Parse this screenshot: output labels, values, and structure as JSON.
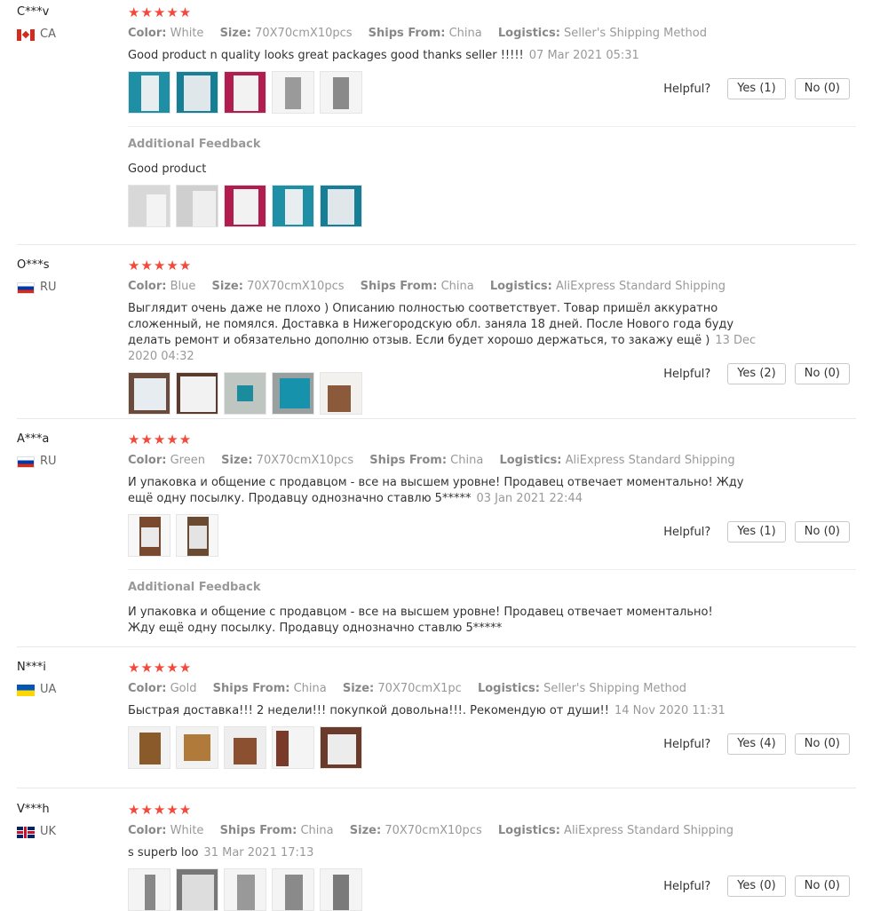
{
  "labels": {
    "color": "Color:",
    "size": "Size:",
    "ships": "Ships From:",
    "logistics": "Logistics:",
    "helpful": "Helpful?",
    "additional": "Additional Feedback",
    "stars": "★★★★★"
  },
  "reviews": [
    {
      "user": "C***v",
      "country": "CA",
      "flag": "ca",
      "rating": 5,
      "color": "White",
      "size": "70X70cmX10pcs",
      "ships": "China",
      "logistics": "Seller's Shipping Method",
      "text": "Good product n quality looks great packages good thanks seller !!!!!",
      "date": "07 Mar 2021 05:31",
      "yes": "Yes (1)",
      "no": "No (0)",
      "additional": "Good product"
    },
    {
      "user": "O***s",
      "country": "RU",
      "flag": "ru",
      "rating": 5,
      "color": "Blue",
      "size": "70X70cmX10pcs",
      "ships": "China",
      "logistics": "AliExpress Standard Shipping",
      "text": "Выглядит очень даже не плохо ) Описанию полностью соответствует. Товар пришёл аккуратно сложенный, не помялся. Доставка в Нижегородскую обл. заняла 18 дней. После Нового года буду делать ремонт и обязательно дополню отзыв. Если будет хорошо держаться, то закажу ещё )",
      "date": "13 Dec 2020 04:32",
      "yes": "Yes (2)",
      "no": "No (0)"
    },
    {
      "user": "A***a",
      "country": "RU",
      "flag": "ru",
      "rating": 5,
      "color": "Green",
      "size": "70X70cmX10pcs",
      "ships": "China",
      "logistics": "AliExpress Standard Shipping",
      "text": "И упаковка и общение с продавцом - все на высшем уровне! Продавец отвечает моментально! Жду ещё одну посылку. Продавцу однозначно ставлю 5*****",
      "date": "03 Jan 2021 22:44",
      "yes": "Yes (1)",
      "no": "No (0)",
      "additional": "И упаковка и общение с продавцом - все на высшем уровне! Продавец отвечает моментально! Жду ещё одну посылку. Продавцу однозначно ставлю 5*****"
    },
    {
      "user": "N***i",
      "country": "UA",
      "flag": "ua",
      "rating": 5,
      "color": "Gold",
      "ships": "China",
      "size": "70X70cmX1pc",
      "logistics": "Seller's Shipping Method",
      "text": "Быстрая доставка!!! 2 недели!!! покупкой довольна!!!. Рекомендую от души!!",
      "date": "14 Nov 2020 11:31",
      "yes": "Yes (4)",
      "no": "No (0)"
    },
    {
      "user": "V***h",
      "country": "UK",
      "flag": "uk",
      "rating": 5,
      "color": "White",
      "ships": "China",
      "size": "70X70cmX10pcs",
      "logistics": "AliExpress Standard Shipping",
      "text": "s superb loo",
      "date": "31 Mar 2021 17:13",
      "yes": "Yes (0)",
      "no": "No (0)"
    }
  ],
  "colors": {
    "star": "#f3483a",
    "border": "#c9c9c9"
  }
}
